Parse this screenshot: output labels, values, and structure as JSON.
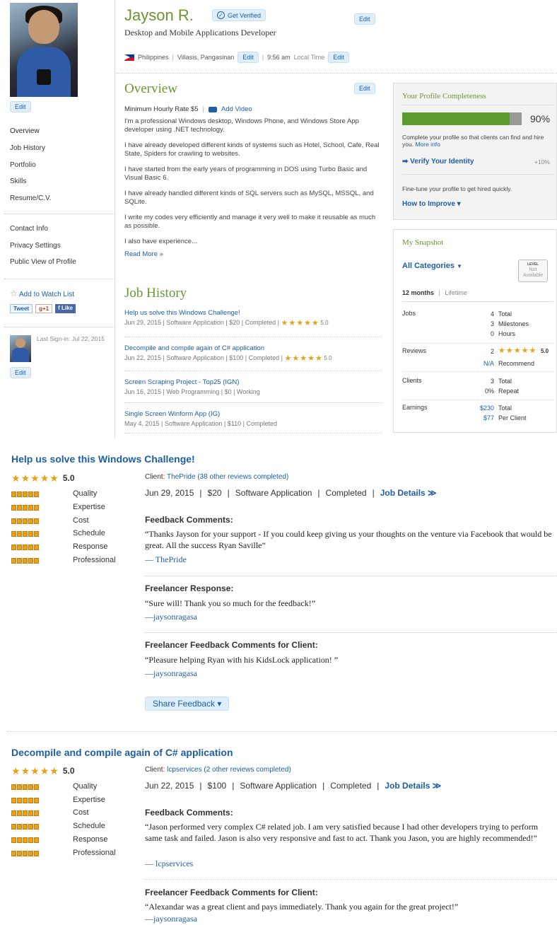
{
  "sidebar": {
    "photo_edit": "Edit",
    "nav": [
      "Overview",
      "Job History",
      "Portfolio",
      "Skills",
      "Resume/C.V."
    ],
    "settings": [
      "Contact Info",
      "Privacy Settings",
      "Public View of Profile"
    ],
    "watch_list": "Add to Watch List",
    "tweet": "Tweet",
    "gplus": "g+1",
    "like": "Like",
    "last_signin": "Last Sign-in: Jul 22, 2015",
    "small_edit": "Edit"
  },
  "header": {
    "name": "Jayson R.",
    "verify": "Get Verified",
    "edit": "Edit",
    "subtitle": "Desktop and Mobile Applications Developer",
    "country": "Philippines",
    "city": "Villasis, Pangasinan",
    "location_edit": "Edit",
    "time": "9:56 am",
    "time_label": "Local Time",
    "time_edit": "Edit"
  },
  "overview": {
    "title": "Overview",
    "edit": "Edit",
    "rate": "Minimum Hourly Rate $5",
    "add_video": "Add Video",
    "paragraphs": [
      "I'm a professional Windows desktop, Windows Phone, and Windows Store App developer using .NET technology.",
      "I have already developed different kinds of systems such as Hotel, School, Cafe, Real State, Spiders for crawling to websites.",
      "I have started from the early years of programming in DOS using Turbo Basic and Visual Basic 6.",
      "I have already handled different kinds of SQL servers such as MySQL, MSSQL, and SQLite.",
      "I write my codes very efficiently and manage it very well to make it reusable as much as possible.",
      "I also have experience..."
    ],
    "read_more": "Read More »"
  },
  "job_history": {
    "title": "Job History",
    "items": [
      {
        "title": "Help us solve this Windows Challenge!",
        "meta": "Jun 29, 2015 | Software Application | $20 | Completed |",
        "rating": "5.0",
        "stars": 5
      },
      {
        "title": "Decompile and compile again of C# application",
        "meta": "Jun 22, 2015 | Software Application | $100 | Completed |",
        "rating": "5.0",
        "stars": 5
      },
      {
        "title": "Screen Scraping Project - Top25 (IGN)",
        "meta": "Jun 16, 2015 | Web Programming | $0 | Working",
        "rating": "",
        "stars": 0
      },
      {
        "title": "Single Screen Winform App (IG)",
        "meta": "May 4, 2015 | Software Application | $110 | Completed",
        "rating": "",
        "stars": 0
      }
    ]
  },
  "completeness": {
    "title": "Your Profile Completeness",
    "percent_label": "90%",
    "percent": 0.9,
    "desc": "Complete your profile so that clients can find and hire you.",
    "more_info": "More info",
    "verify_identity": "Verify Your Identity",
    "verify_bonus": "+10%",
    "finetune": "Fine-tune your profile to get hired quickly.",
    "how_to": "How to Improve ▾"
  },
  "snapshot": {
    "title": "My Snapshot",
    "category": "All Categories",
    "level_label": "LEVEL",
    "level_value": "Not Available",
    "period_active": "12 months",
    "period_other": "Lifetime",
    "jobs_label": "Jobs",
    "jobs": [
      {
        "n": "4",
        "l": "Total"
      },
      {
        "n": "3",
        "l": "Milestones"
      },
      {
        "n": "0",
        "l": "Hours"
      }
    ],
    "reviews_label": "Reviews",
    "reviews_count": "2",
    "reviews_rating": "5.0",
    "recommend_n": "N/A",
    "recommend_l": "Recommend",
    "clients_label": "Clients",
    "clients": [
      {
        "n": "3",
        "l": "Total"
      },
      {
        "n": "0%",
        "l": "Repeat"
      }
    ],
    "earnings_label": "Earnings",
    "earnings": [
      {
        "n": "$230",
        "l": "Total"
      },
      {
        "n": "$77",
        "l": "Per Client"
      }
    ]
  },
  "reviews": [
    {
      "title": "Help us solve this Windows Challenge!",
      "rating": "5.0",
      "criteria": [
        "Quality",
        "Expertise",
        "Cost",
        "Schedule",
        "Response",
        "Professional"
      ],
      "client_label": "Client:",
      "client": "ThePride",
      "client_others": "(38 other reviews completed)",
      "date": "Jun 29, 2015",
      "amount": "$20",
      "category": "Software Application",
      "status": "Completed",
      "details": "Job Details ≫",
      "feedback_label": "Feedback Comments:",
      "feedback": "“Thanks Jayson for your support - If you could keep giving us your thoughts on the venture via Facebook that would be great. All the success Ryan Saville”",
      "feedback_sig": "— ThePride",
      "response_label": "Freelancer Response:",
      "response": "“Sure will! Thank you so much for the feedback!”",
      "response_sig": "—jaysonragasa",
      "client_fb_label": "Freelancer Feedback Comments for Client:",
      "client_fb": "“Pleasure helping Ryan with his KidsLock application! ”",
      "client_fb_sig": "—jaysonragasa",
      "share": "Share Feedback ▾"
    },
    {
      "title": "Decompile and compile again of C# application",
      "rating": "5.0",
      "criteria": [
        "Quality",
        "Expertise",
        "Cost",
        "Schedule",
        "Response",
        "Professional"
      ],
      "client_label": "Client:",
      "client": "lcpservices",
      "client_others": "(2 other reviews completed)",
      "date": "Jun 22, 2015",
      "amount": "$100",
      "category": "Software Application",
      "status": "Completed",
      "details": "Job Details ≫",
      "feedback_label": "Feedback Comments:",
      "feedback": "“Jason performed very complex C# related job. I am very satisfied because I had other developers trying to perform same task and failed. Jason is also very responsive and fast to act. Thank you Jason, you are highly recommended!”",
      "feedback_sig": "— lcpservices",
      "client_fb_label": "Freelancer Feedback Comments for Client:",
      "client_fb": "“Alexandar was a great client and pays immediately. Thank you again for the great project!”",
      "client_fb_sig": "—jaysonragasa"
    }
  ],
  "colors": {
    "accent_green": "#6a962f",
    "link_blue": "#1d5ea6",
    "star_orange": "#e7a11a"
  }
}
